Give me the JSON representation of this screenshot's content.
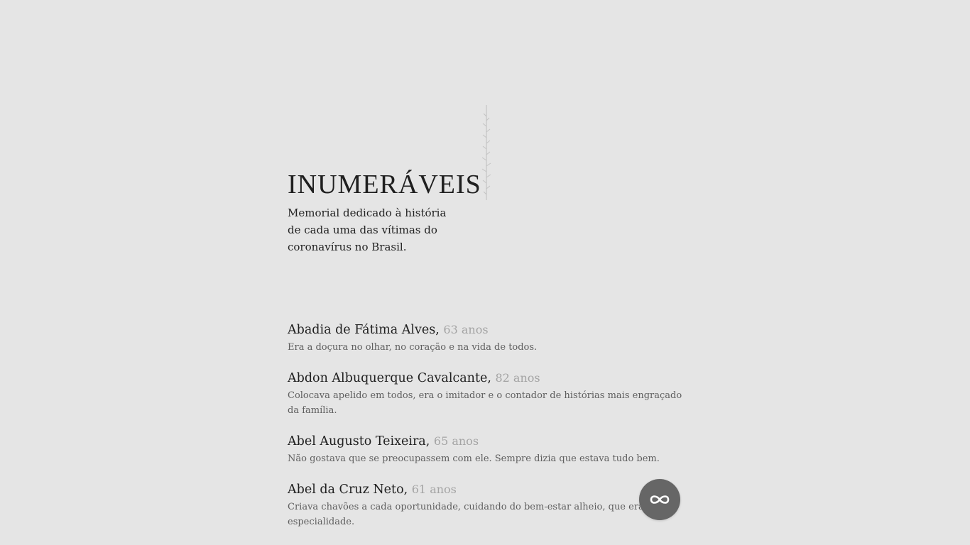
{
  "header": {
    "title": "INUMERÁVEIS",
    "subtitle": "Memorial dedicado à história de cada uma das vítimas do coronavírus no Brasil."
  },
  "entries": [
    {
      "name": "Abadia de Fátima Alves,",
      "age": "63 anos",
      "description": "Era a doçura no olhar, no coração e na vida de todos."
    },
    {
      "name": "Abdon Albuquerque Cavalcante,",
      "age": "82 anos",
      "description": "Colocava apelido em todos, era o imitador e o contador de histórias mais engraçado da família."
    },
    {
      "name": "Abel Augusto Teixeira,",
      "age": "65 anos",
      "description": "Não gostava que se preocupassem com ele. Sempre dizia que estava tudo bem."
    },
    {
      "name": "Abel da Cruz Neto,",
      "age": "61 anos",
      "description": "Criava chavões a cada oportunidade, cuidando do bem-estar alheio, que era sua especialidade."
    }
  ],
  "fab": {
    "icon": "infinity-icon",
    "background": "#666666"
  },
  "colors": {
    "background": "#e5e5e5",
    "text": "#1f1f1f",
    "age": "#a4a4a4",
    "description": "#5e5e5e"
  }
}
